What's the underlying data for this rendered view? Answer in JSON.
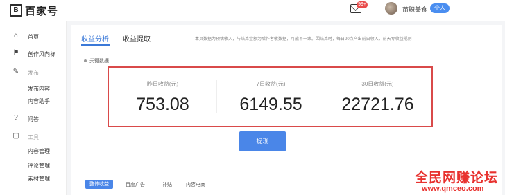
{
  "header": {
    "logo_text": "百家号",
    "mail_badge": "99+",
    "username": "苗职美食",
    "user_tag": "个人"
  },
  "sidebar": {
    "items": [
      {
        "icon": "home-icon",
        "label": "首页"
      },
      {
        "icon": "flag-icon",
        "label": "创作风向标"
      },
      {
        "icon": "edit-icon",
        "label": "发布",
        "sub": [
          "发布内容",
          "内容助手"
        ]
      },
      {
        "icon": "help-icon",
        "label": "问答"
      },
      {
        "icon": "tools-icon",
        "label": "工具",
        "sub": [
          "内容管理",
          "评论管理",
          "素材管理"
        ]
      }
    ]
  },
  "main": {
    "tabs": [
      "收益分析",
      "收益提取"
    ],
    "notice": "本页数据为预估收入，与结算金额为后作者收数据，可能不一致。因结算时，每日20点产出前日收入，前天专收益规则",
    "notice_link": "收益规则",
    "section_label": "关键数据",
    "stats": [
      {
        "label": "昨日收益(元)",
        "value": "753.08"
      },
      {
        "label": "7日收益(元)",
        "value": "6149.55"
      },
      {
        "label": "30日收益(元)",
        "value": "22721.76"
      }
    ],
    "withdraw_label": "提现",
    "bottom_tabs": [
      "整体收益",
      "百度广告",
      "补贴",
      "内容电商"
    ]
  },
  "watermark": {
    "cn": "全民网赚论坛",
    "url": "www.qmceo.com"
  },
  "colors": {
    "accent": "#4a86e8",
    "highlight_border": "#d94a4a",
    "watermark": "#e8322f"
  }
}
